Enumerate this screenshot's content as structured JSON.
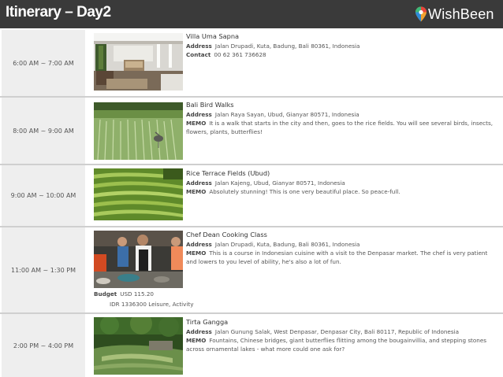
{
  "header": {
    "title": "Itinerary – Day2",
    "brand": "WishBeen"
  },
  "items": [
    {
      "time": "6:00 AM ~ 7:00 AM",
      "place": "Villa Uma Sapna",
      "address_label": "Address",
      "address": "Jalan Drupadi, Kuta, Badung, Bali 80361, Indonesia",
      "second_label": "Contact",
      "second": "00 62 361 736628"
    },
    {
      "time": "8:00 AM ~ 9:00 AM",
      "place": "Bali Bird Walks",
      "address_label": "Address",
      "address": "Jalan Raya Sayan, Ubud, Gianyar 80571, Indonesia",
      "second_label": "MEMO",
      "second": "It is a walk that starts in the city and then, goes to the rice fields. You will see several birds, insects, flowers, plants, butterflies!"
    },
    {
      "time": "9:00 AM ~ 10:00 AM",
      "place": "Rice Terrace Fields (Ubud)",
      "address_label": "Address",
      "address": "Jalan Kajeng, Ubud, Gianyar 80571, Indonesia",
      "second_label": "MEMO",
      "second": "Absolutely stunning! This is one very beautiful place. So peace-full."
    },
    {
      "time": "11:00 AM ~ 1:30 PM",
      "place": "Chef Dean Cooking Class",
      "address_label": "Address",
      "address": "Jalan Drupadi, Kuta, Badung, Bali 80361, Indonesia",
      "second_label": "MEMO",
      "second": "This is a course in Indonesian cuisine with a visit to the Denpasar market. The chef is very patient and lowers to you level of ability, he's also a lot of fun.",
      "budget_label": "Budget",
      "budget_usd": "USD 115.20",
      "budget_idr": "IDR 1336300 Leisure, Activity"
    },
    {
      "time": "2:00 PM ~ 4:00 PM",
      "place": "Tirta Gangga",
      "address_label": "Address",
      "address": "Jalan Gunung Salak, West Denpasar, Denpasar City, Bali 80117, Republic of Indonesia",
      "second_label": "MEMO",
      "second": "Fountains, Chinese bridges, giant butterflies flitting among the bougainvillia, and stepping stones across ornamental lakes - what more could one ask for?"
    }
  ]
}
